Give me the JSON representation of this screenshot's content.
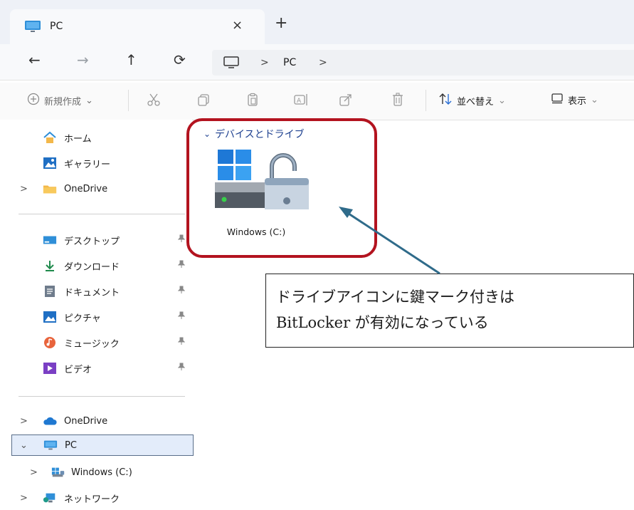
{
  "window": {
    "tab_title": "PC",
    "tab_close": "×",
    "new_tab": "+"
  },
  "nav": {
    "back": "←",
    "forward": "→",
    "up": "↑",
    "refresh": "⟳",
    "address_sep": ">",
    "breadcrumb": "PC",
    "address_sep_end": ">"
  },
  "toolbar": {
    "new_label": "新規作成",
    "new_chevron": "⌄",
    "sort_label": "並べ替え",
    "sort_chevron": "⌄",
    "view_label": "表示",
    "view_chevron": "⌄"
  },
  "sidebar": {
    "chevron_right": ">",
    "chevron_down": "⌄",
    "pin": "📌",
    "items": [
      {
        "label": "ホーム"
      },
      {
        "label": "ギャラリー"
      },
      {
        "label": "OneDrive"
      },
      {
        "label": "デスクトップ"
      },
      {
        "label": "ダウンロード"
      },
      {
        "label": "ドキュメント"
      },
      {
        "label": "ピクチャ"
      },
      {
        "label": "ミュージック"
      },
      {
        "label": "ビデオ"
      },
      {
        "label": "OneDrive"
      },
      {
        "label": "PC"
      },
      {
        "label": "Windows (C:)"
      },
      {
        "label": "ネットワーク"
      }
    ]
  },
  "content": {
    "group_chevron": "⌄",
    "group_title": "デバイスとドライブ",
    "drive_label": "Windows (C:)"
  },
  "annotation": {
    "line1": "ドライブアイコンに鍵マーク付きは",
    "line2": "BitLocker が有効になっている",
    "highlight_color": "#b3131f",
    "arrow_color": "#2f6b8a"
  }
}
